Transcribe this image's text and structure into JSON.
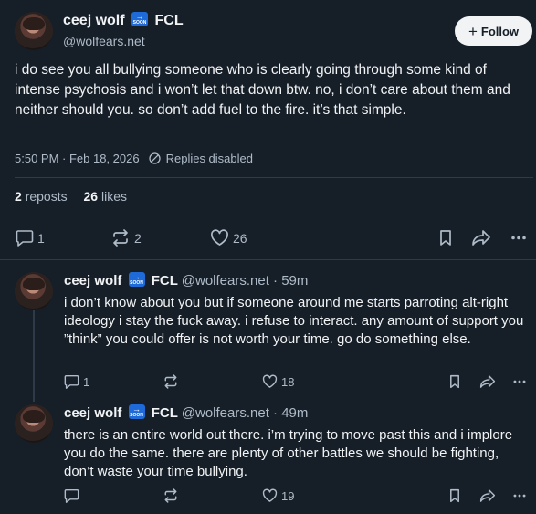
{
  "post": {
    "author_name": "ceej wolf",
    "author_suffix": "FCL",
    "badge_text": "SOON",
    "handle": "@wolfears.net",
    "follow_label": "Follow",
    "text": "i do see you all bullying someone who is clearly going through some kind of intense psychosis and i won’t let that down btw. no, i don’t care about them and neither should you. so don’t add fuel to the fire. it’s that simple.",
    "timestamp": "5:50 PM · Feb 18, 2026",
    "replies_status": "Replies disabled",
    "reposts_count": "2",
    "reposts_label": "reposts",
    "likes_count": "26",
    "likes_label": "likes",
    "reply_count": "1",
    "repost_count": "2",
    "like_count": "26"
  },
  "replies": [
    {
      "author_name": "ceej wolf",
      "author_suffix": "FCL",
      "handle_time": "@wolfears.net · 59m",
      "text": "i don’t know about you but if someone around me starts parroting alt-right ideology i stay the fuck away. i refuse to interact. any amount of support you ”think” you could offer is not worth your time. go do something else.",
      "reply_count": "1",
      "like_count": "18"
    },
    {
      "author_name": "ceej wolf",
      "author_suffix": "FCL",
      "handle_time": "@wolfears.net · 49m",
      "text": "there is an entire world out there. i’m trying to move past this and i implore you do the same. there are plenty of other battles we should be fighting, don’t waste your time bullying.",
      "reply_count": "",
      "like_count": "19"
    }
  ],
  "colors": {
    "background": "#161e27",
    "text": "#f1f3f5",
    "muted": "#aebbc9",
    "badge": "#1e6ad9"
  }
}
